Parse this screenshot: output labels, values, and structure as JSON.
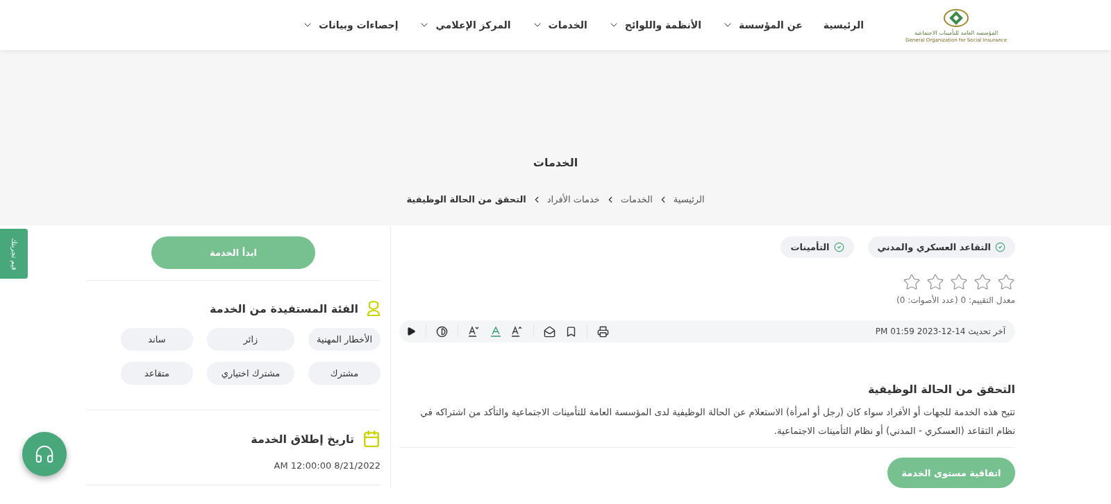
{
  "header": {
    "logo": {
      "arabic": "المؤسسة العامة للتأمينات الاجتماعية",
      "english": "General Organization for Social Insurance"
    },
    "nav": [
      {
        "label": "الرئيسية",
        "dropdown": false
      },
      {
        "label": "عن المؤسسة",
        "dropdown": true
      },
      {
        "label": "الأنظمة واللوائح",
        "dropdown": true
      },
      {
        "label": "الخدمات",
        "dropdown": true
      },
      {
        "label": "المركز الإعلامي",
        "dropdown": true
      },
      {
        "label": "إحصاءات وبيانات",
        "dropdown": true
      }
    ]
  },
  "banner": {
    "title": "الخدمات",
    "breadcrumb": [
      {
        "label": "الرئيسية",
        "current": false
      },
      {
        "label": "الخدمات",
        "current": false
      },
      {
        "label": "خدمات الأفراد",
        "current": false
      },
      {
        "label": "التحقق من الحالة الوظيفية",
        "current": true
      }
    ]
  },
  "service": {
    "tags": [
      "التقاعد العسكري والمدني",
      "التأمينات"
    ],
    "rating": {
      "stars": 0,
      "summary": "معدل التقييم: 0 (عدد الأصوات: 0)"
    },
    "last_update": "آخر تحديث 14-12-2023 01:59 PM",
    "title": "التحقق من الحالة الوظيفية",
    "description": "تتيح هذه الخدمة للجهات أو الأفراد سواء كان (رجل أو امرأة) الاستعلام عن الحالة الوظيفية لدى المؤسسة العامة للتأمينات الاجتماعية والتأكد من اشتراكه في نظام التقاعد (العسكري - المدني) أو نظام التأمينات الاجتماعية.",
    "sla_button": "اتفاقية مستوى الخدمة"
  },
  "sidebar": {
    "start_button": "ابدأ الخدمة",
    "beneficiaries": {
      "title": "الفئة المستفيدة من الخدمة",
      "items": [
        "الأخطار المهنية",
        "زائر",
        "ساند",
        "مشترك",
        "مشترك اختياري",
        "متقاعد"
      ]
    },
    "launch": {
      "title": "تاريخ إطلاق الخدمة",
      "date": "AM 12:00:00 8/21/2022"
    }
  },
  "feedback_tab": "قيم تجربتك"
}
